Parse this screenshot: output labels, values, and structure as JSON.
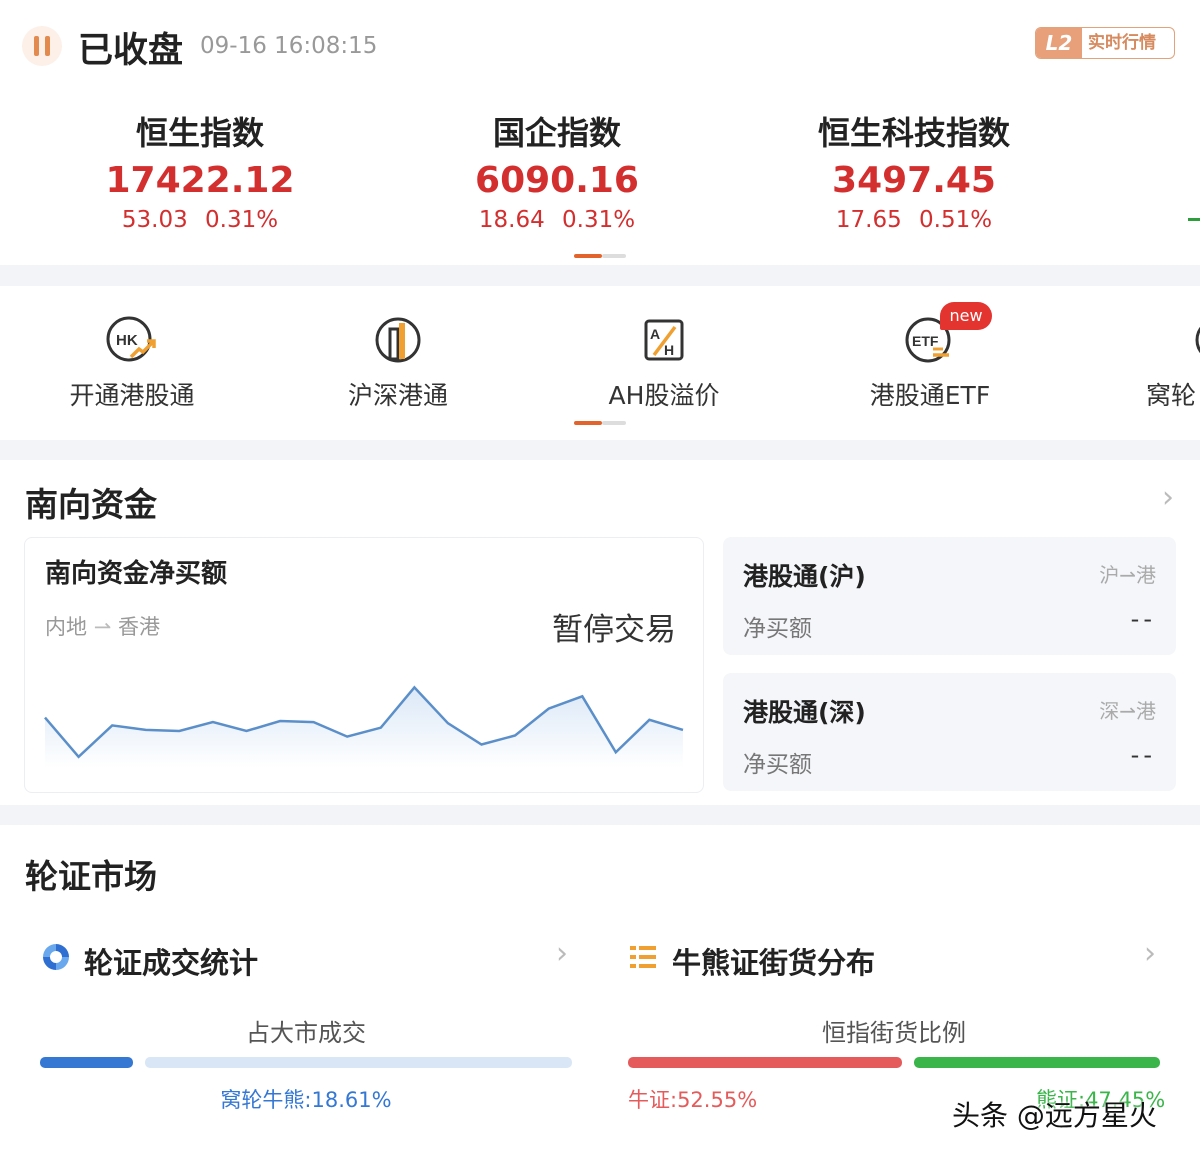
{
  "header": {
    "status": "已收盘",
    "time": "09-16 16:08:15",
    "l2_badge": "L2",
    "l2_label": "实时行情"
  },
  "indices": [
    {
      "name": "恒生指数",
      "value": "17422.12",
      "change": "53.03",
      "pct": "0.31%"
    },
    {
      "name": "国企指数",
      "value": "6090.16",
      "change": "18.64",
      "pct": "0.31%"
    },
    {
      "name": "恒生科技指数",
      "value": "3497.45",
      "change": "17.65",
      "pct": "0.51%"
    }
  ],
  "nav": {
    "items": [
      {
        "label": "开通港股通",
        "icon": "hk-growth-icon"
      },
      {
        "label": "沪深港通",
        "icon": "building-icon"
      },
      {
        "label": "AH股溢价",
        "icon": "ah-icon"
      },
      {
        "label": "港股通ETF",
        "icon": "etf-icon"
      },
      {
        "label": "窝轮",
        "icon": "warrant-icon"
      }
    ],
    "new_badge": "new"
  },
  "southbound": {
    "title": "南向资金",
    "chart_title": "南向资金净买额",
    "direction": "内地",
    "direction_to": "香港",
    "paused": "暂停交易",
    "panels": [
      {
        "name": "港股通(沪)",
        "route_from": "沪",
        "route_to": "港",
        "label": "净买额",
        "value": "--"
      },
      {
        "name": "港股通(深)",
        "route_from": "深",
        "route_to": "港",
        "label": "净买额",
        "value": "--"
      }
    ]
  },
  "chart_data": {
    "type": "area",
    "title": "南向资金净买额",
    "x": [
      0,
      1,
      2,
      3,
      4,
      5,
      6,
      7,
      8,
      9,
      10,
      11,
      12,
      13,
      14,
      15,
      16,
      17,
      18,
      19
    ],
    "values": [
      45,
      10,
      38,
      34,
      33,
      41,
      33,
      42,
      41,
      28,
      36,
      72,
      40,
      21,
      29,
      53,
      64,
      14,
      43,
      34
    ],
    "ylim": [
      0,
      100
    ],
    "colors": {
      "line": "#5b8fc9",
      "fill_top": "#dbe8f7",
      "fill_bottom": "#ffffff"
    }
  },
  "warrants": {
    "title": "轮证市场",
    "stats": {
      "title": "轮证成交统计",
      "subtitle": "占大市成交",
      "label": "窝轮牛熊:18.61%",
      "share": 0.1861,
      "colors": {
        "fill": "#3478d4",
        "rest": "#d9e6f6"
      }
    },
    "cbbc": {
      "title": "牛熊证街货分布",
      "subtitle": "恒指街货比例",
      "bull_label": "牛证:52.55%",
      "bear_label": "熊证:47.45%",
      "bull_share": 0.5255,
      "colors": {
        "bull": "#e55b5b",
        "bear": "#3ab54a"
      }
    }
  },
  "watermark": "头条 @远方星火",
  "colors": {
    "up": "#d32f2f",
    "accent": "#e3632c"
  }
}
